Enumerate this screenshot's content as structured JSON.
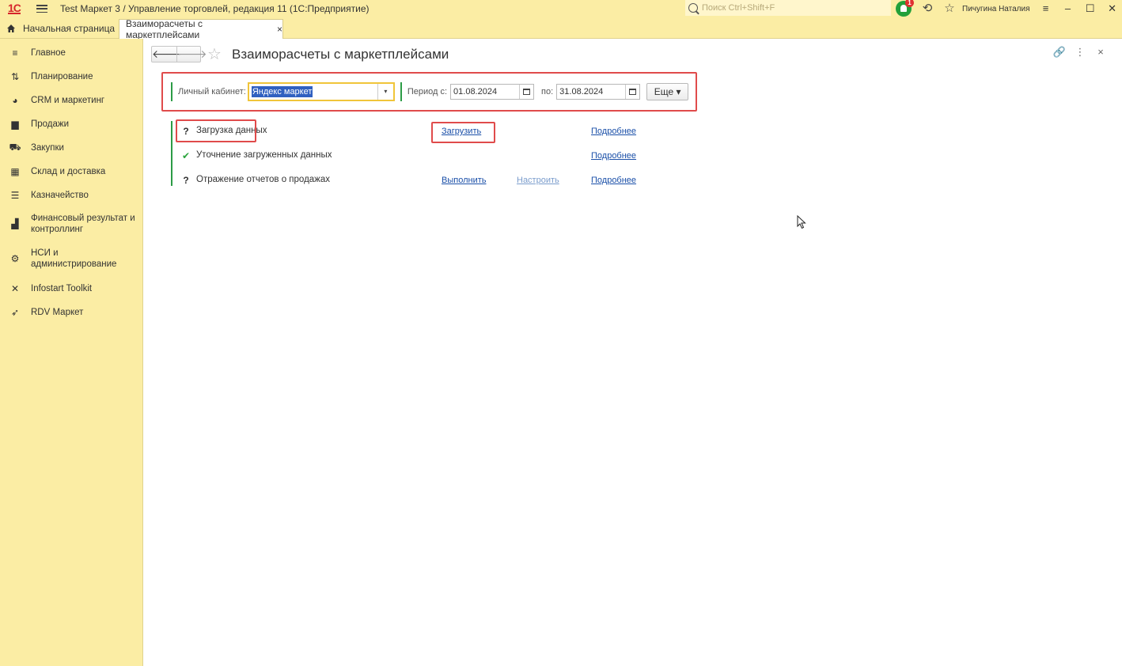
{
  "titlebar": {
    "logo": "1С",
    "title": "Test Маркет 3 / Управление торговлей, редакция 11  (1С:Предприятие)",
    "search_placeholder": "Поиск Ctrl+Shift+F",
    "notification_count": "1",
    "user": "Пичугина Наталия"
  },
  "tabs": {
    "home": "Начальная страница",
    "active": "Взаиморасчеты с маркетплейсами",
    "close": "×"
  },
  "sidebar": {
    "items": [
      {
        "label": "Главное",
        "icon": "menu-lines-icon"
      },
      {
        "label": "Планирование",
        "icon": "planning-icon"
      },
      {
        "label": "CRM и маркетинг",
        "icon": "pie-chart-icon"
      },
      {
        "label": "Продажи",
        "icon": "shopping-bag-icon"
      },
      {
        "label": "Закупки",
        "icon": "cart-icon"
      },
      {
        "label": "Склад и доставка",
        "icon": "warehouse-icon"
      },
      {
        "label": "Казначейство",
        "icon": "coins-icon"
      },
      {
        "label": "Финансовый результат и контроллинг",
        "icon": "bar-chart-icon"
      },
      {
        "label": "НСИ и администрирование",
        "icon": "gear-icon"
      },
      {
        "label": "Infostart Toolkit",
        "icon": "tools-icon"
      },
      {
        "label": "RDV Маркет",
        "icon": "rocket-icon"
      }
    ]
  },
  "page": {
    "title": "Взаиморасчеты с маркетплейсами"
  },
  "filter": {
    "cabinet_label": "Личный кабинет:",
    "cabinet_value": "Яндекс маркет",
    "period_from_label": "Период с:",
    "period_from": "01.08.2024",
    "period_to_label": "по:",
    "period_to": "31.08.2024",
    "more_label": "Еще"
  },
  "steps": [
    {
      "status": "?",
      "name": "Загрузка данных",
      "action": "Загрузить",
      "setup": "",
      "details": "Подробнее"
    },
    {
      "status": "✔",
      "name": "Уточнение загруженных данных",
      "action": "",
      "setup": "",
      "details": "Подробнее"
    },
    {
      "status": "?",
      "name": "Отражение отчетов о продажах",
      "action": "Выполнить",
      "setup": "Настроить",
      "details": "Подробнее"
    }
  ],
  "colors": {
    "panel_bg": "#fbeda4",
    "accent_green": "#2c9c46",
    "highlight_red": "#e04b4b",
    "link_blue": "#1a4fa8"
  }
}
